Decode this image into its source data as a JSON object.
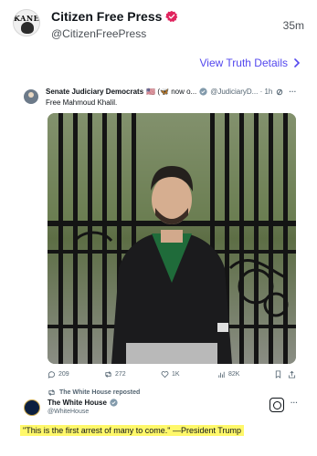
{
  "post": {
    "display_name": "Citizen Free Press",
    "handle": "@CitizenFreePress",
    "time": "35m",
    "avatar_text": "KANE",
    "view_truth_label": "View Truth Details",
    "colors": {
      "link": "#5448ee",
      "verified": "#e0245e"
    }
  },
  "embedded_tweet": {
    "author": "Senate Judiciary Democrats",
    "author_suffix": "🇺🇸 (🦋 now o...",
    "handle_time": "@JudiciaryD... · 1h",
    "more_icon": "···",
    "text": "Free Mahmoud Khalil.",
    "metrics": {
      "replies": "209",
      "reposts": "272",
      "likes": "1K",
      "views": "82K"
    },
    "repost_note": "The White House reposted"
  },
  "retweeter": {
    "name": "The White House",
    "handle": "@WhiteHouse",
    "more_icon": "···"
  },
  "highlighted_quote": "\"This is the first arrest of many to come.\" —President Trump"
}
